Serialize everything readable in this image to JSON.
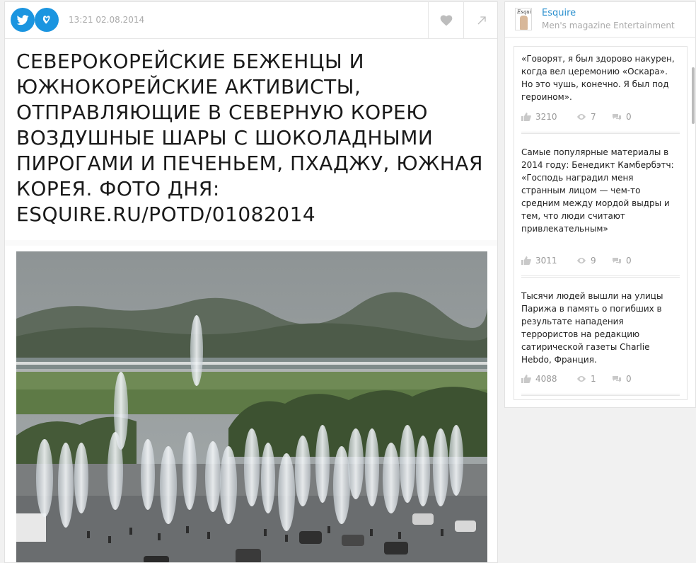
{
  "post": {
    "timestamp": "13:21 02.08.2014",
    "title": "СЕВЕРОКОРЕЙСКИЕ БЕЖЕНЦЫ И ЮЖНОКОРЕЙСКИЕ АКТИВИСТЫ, ОТПРАВЛЯЮЩИЕ В СЕВЕРНУЮ КОРЕЮ ВОЗДУШНЫЕ ШАРЫ С ШОКОЛАДНЫМИ ПИРОГАМИ И ПЕЧЕНЬЕМ, ПХАДЖУ, ЮЖНАЯ КОРЕЯ. ФОТО ДНЯ: ESQUIRE.RU/POTD/01082014",
    "icons": [
      "twitter-icon",
      "vk-icon",
      "heart-icon",
      "share-arrow-icon"
    ],
    "accent": "#1b95e0"
  },
  "sidebar": {
    "logo_text": "Esquire",
    "name": "Esquire",
    "description": "Men's magazine Entertainment",
    "items": [
      {
        "text": "«Говорят, я был здорово накурен, когда вел церемонию «Оскара». Но это чушь, конечно. Я был под героином».",
        "likes": "3210",
        "views": "7",
        "comments": "0"
      },
      {
        "text": "Самые популярные материалы в 2014 году: Бенедикт Камбербэтч: «Господь наградил меня странным лицом — чем-то средним между мордой выдры и тем, что люди считают привлекательным»",
        "likes": "3011",
        "views": "9",
        "comments": "0"
      },
      {
        "text": "Тысячи людей вышли на улицы Парижа в память о погибших в результате нападения террористов на редакцию сатирической газеты Charlie Hebdo, Франция.",
        "likes": "4088",
        "views": "1",
        "comments": "0"
      }
    ]
  }
}
